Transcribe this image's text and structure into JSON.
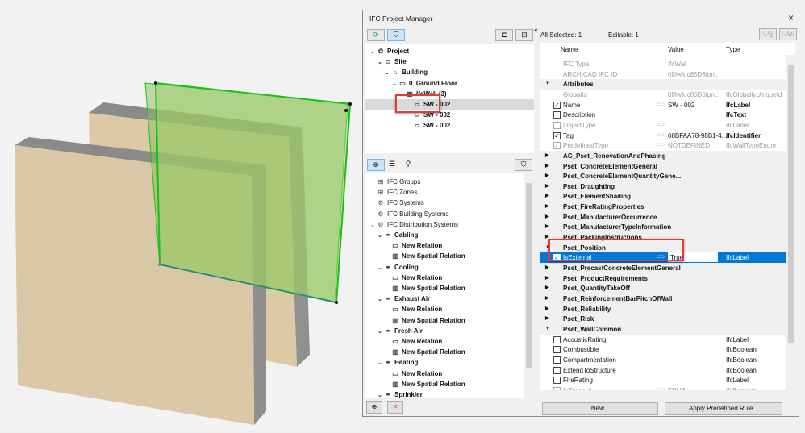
{
  "dialog": {
    "title": "IFC Project Manager",
    "close_icon": "×"
  },
  "tree": [
    {
      "label": "Project",
      "icon": "✿",
      "depth": 0,
      "chev": "v",
      "bold": true
    },
    {
      "label": "Site",
      "icon": "▱",
      "depth": 1,
      "chev": "v",
      "bold": true
    },
    {
      "label": "Building",
      "icon": "⌂",
      "depth": 2,
      "chev": "v",
      "bold": true
    },
    {
      "label": "0. Ground Floor",
      "icon": "▭",
      "depth": 3,
      "chev": "v",
      "bold": true
    },
    {
      "label": "IfcWall (3)",
      "icon": "▦",
      "depth": 4,
      "chev": "v",
      "bold": true
    },
    {
      "label": "SW - 002",
      "icon": "▱",
      "depth": 5,
      "chev": "",
      "bold": true,
      "selected": true
    },
    {
      "label": "SW - 002",
      "icon": "▱",
      "depth": 5,
      "chev": "",
      "bold": true
    },
    {
      "label": "SW - 002",
      "icon": "▱",
      "depth": 5,
      "chev": "",
      "bold": true
    }
  ],
  "lower_list": [
    {
      "label": "IFC Groups",
      "icon": "⊞",
      "depth": 0,
      "chev": ""
    },
    {
      "label": "IFC Zones",
      "icon": "⊞",
      "depth": 0,
      "chev": ""
    },
    {
      "label": "IFC Systems",
      "icon": "⚙",
      "depth": 0,
      "chev": ""
    },
    {
      "label": "IFC Building Systems",
      "icon": "⚙",
      "depth": 0,
      "chev": ""
    },
    {
      "label": "IFC Distribution Systems",
      "icon": "⚙",
      "depth": 0,
      "chev": "v"
    },
    {
      "label": "Cabling",
      "icon": "⚭",
      "depth": 1,
      "chev": "v",
      "bold": true
    },
    {
      "label": "New Relation",
      "icon": "▭",
      "depth": 2,
      "chev": "",
      "bold": true
    },
    {
      "label": "New Spatial Relation",
      "icon": "▥",
      "depth": 2,
      "chev": "",
      "bold": true
    },
    {
      "label": "Cooling",
      "icon": "⚭",
      "depth": 1,
      "chev": "v",
      "bold": true
    },
    {
      "label": "New Relation",
      "icon": "▭",
      "depth": 2,
      "chev": "",
      "bold": true
    },
    {
      "label": "New Spatial Relation",
      "icon": "▥",
      "depth": 2,
      "chev": "",
      "bold": true
    },
    {
      "label": "Exhaust Air",
      "icon": "⚭",
      "depth": 1,
      "chev": "v",
      "bold": true
    },
    {
      "label": "New Relation",
      "icon": "▭",
      "depth": 2,
      "chev": "",
      "bold": true
    },
    {
      "label": "New Spatial Relation",
      "icon": "▥",
      "depth": 2,
      "chev": "",
      "bold": true
    },
    {
      "label": "Fresh Air",
      "icon": "⚭",
      "depth": 1,
      "chev": "v",
      "bold": true
    },
    {
      "label": "New Relation",
      "icon": "▭",
      "depth": 2,
      "chev": "",
      "bold": true
    },
    {
      "label": "New Spatial Relation",
      "icon": "▥",
      "depth": 2,
      "chev": "",
      "bold": true
    },
    {
      "label": "Heating",
      "icon": "⚭",
      "depth": 1,
      "chev": "v",
      "bold": true
    },
    {
      "label": "New Relation",
      "icon": "▭",
      "depth": 2,
      "chev": "",
      "bold": true
    },
    {
      "label": "New Spatial Relation",
      "icon": "▥",
      "depth": 2,
      "chev": "",
      "bold": true
    },
    {
      "label": "Sprinkler",
      "icon": "⚭",
      "depth": 1,
      "chev": "v",
      "bold": true
    }
  ],
  "header": {
    "all_selected": "All Selected: 1",
    "editable": "Editable: 1"
  },
  "columns": {
    "name": "Name",
    "value": "Value",
    "type": "Type"
  },
  "props": [
    {
      "kind": "dim",
      "name": "IFC Type",
      "value": "IfcWall",
      "type": ""
    },
    {
      "kind": "dim",
      "name": "ARCHICAD IFC ID",
      "value": "08Iwfuc85D6fpn...",
      "type": ""
    },
    {
      "kind": "group",
      "name": "Attributes",
      "open": true
    },
    {
      "kind": "dim",
      "name": "GlobalId",
      "value": "08Iwfuc85D6fpn...",
      "type": "IfcGloballyUniqueId"
    },
    {
      "kind": "prop",
      "name": "Name",
      "check": "on",
      "link": true,
      "value": "SW - 002",
      "type": "IfcLabel"
    },
    {
      "kind": "prop",
      "name": "Description",
      "check": "off",
      "value": "",
      "type": "IfcText"
    },
    {
      "kind": "dimprop",
      "name": "ObjectType",
      "check": "off",
      "link": true,
      "value": "",
      "type": "IfcLabel"
    },
    {
      "kind": "prop",
      "name": "Tag",
      "check": "on",
      "link": true,
      "value": "08BFAA78-98B1-4...",
      "type": "IfcIdentifier"
    },
    {
      "kind": "dimprop",
      "name": "PredefinedType",
      "check": "on",
      "link": true,
      "value": "NOTDEFINED",
      "type": "IfcWallTypeEnum"
    },
    {
      "kind": "group",
      "name": "AC_Pset_RenovationAndPhasing"
    },
    {
      "kind": "group",
      "name": "Pset_ConcreteElementGeneral"
    },
    {
      "kind": "group",
      "name": "Pset_ConcreteElementQuantityGene..."
    },
    {
      "kind": "group",
      "name": "Pset_Draughting"
    },
    {
      "kind": "group",
      "name": "Pset_ElementShading"
    },
    {
      "kind": "group",
      "name": "Pset_FireRatingProperties"
    },
    {
      "kind": "group",
      "name": "Pset_ManufacturerOccurrence"
    },
    {
      "kind": "group",
      "name": "Pset_ManufacturerTypeInformation"
    },
    {
      "kind": "group",
      "name": "Pset_PackingInstructions"
    },
    {
      "kind": "group",
      "name": "Pset_Position",
      "open": true
    },
    {
      "kind": "edit",
      "name": "IsExternal",
      "check": "on",
      "link": true,
      "value": "True",
      "type": "IfcLabel"
    },
    {
      "kind": "group",
      "name": "Pset_PrecastConcreteElementGeneral"
    },
    {
      "kind": "group",
      "name": "Pset_ProductRequirements"
    },
    {
      "kind": "group",
      "name": "Pset_QuantityTakeOff"
    },
    {
      "kind": "group",
      "name": "Pset_ReinforcementBarPitchOfWall"
    },
    {
      "kind": "group",
      "name": "Pset_Reliability"
    },
    {
      "kind": "group",
      "name": "Pset_Risk"
    },
    {
      "kind": "group",
      "name": "Pset_WallCommon",
      "open": true
    },
    {
      "kind": "prop",
      "name": "AcousticRating",
      "check": "off",
      "value": "",
      "type": "IfcLabel",
      "light": true
    },
    {
      "kind": "prop",
      "name": "Combustible",
      "check": "off",
      "value": "",
      "type": "IfcBoolean",
      "light": true
    },
    {
      "kind": "prop",
      "name": "Compartmentation",
      "check": "off",
      "value": "",
      "type": "IfcBoolean",
      "light": true
    },
    {
      "kind": "prop",
      "name": "ExtendToStructure",
      "check": "off",
      "value": "",
      "type": "IfcBoolean",
      "light": true
    },
    {
      "kind": "prop",
      "name": "FireRating",
      "check": "off",
      "value": "",
      "type": "IfcLabel",
      "light": true
    },
    {
      "kind": "dimprop",
      "name": "IsExternal",
      "check": "on",
      "link": true,
      "value": "TRUE",
      "type": "IfcBoolean"
    }
  ],
  "buttons": {
    "new": "New...",
    "apply": "Apply Predefined Rule..."
  },
  "colors": {
    "accent": "#0078d7",
    "highlight": "#e53935",
    "wall": "#d9c7a5",
    "selected_wall": "#a8c98a"
  }
}
